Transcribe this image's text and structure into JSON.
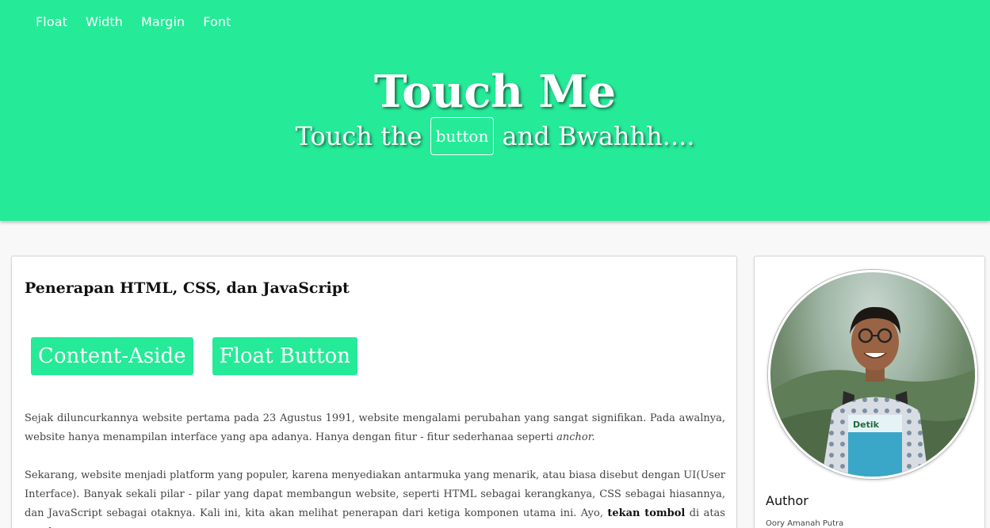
{
  "nav": {
    "items": [
      "Float",
      "Width",
      "Margin",
      "Font"
    ]
  },
  "hero": {
    "title": "Touch Me",
    "sub_before": "Touch the",
    "sub_button": "button",
    "sub_after": "and Bwahhh...."
  },
  "main": {
    "title": "Penerapan HTML, CSS, dan JavaScript",
    "buttons": [
      "Content-Aside",
      "Float Button"
    ],
    "paragraph1_text": "Sejak diluncurkannya website pertama pada 23 Agustus 1991, website mengalami perubahan yang sangat signifikan. Pada awalnya, website hanya menampilan interface yang apa adanya. Hanya dengan fitur - fitur sederhanaa seperti",
    "paragraph1_em": "anchor.",
    "paragraph2_text": "Sekarang, website menjadi platform yang populer, karena menyediakan antarmuka yang menarik, atau biasa disebut dengan UI(User Interface). Banyak sekali pilar - pilar yang dapat membangun website, seperti HTML sebagai kerangkanya, CSS sebagai hiasannya, dan JavaScript sebagai otaknya. Kali ini, kita akan melihat penerapan dari ketiga komponen utama ini. Ayo,",
    "paragraph2_bold": "tekan tombol",
    "paragraph2_tail": "di atas untuk"
  },
  "aside": {
    "author_label": "Author",
    "author_name": "Oory Amanah Putra"
  },
  "colors": {
    "accent": "#25ea98",
    "background": "#f8f8f8"
  }
}
